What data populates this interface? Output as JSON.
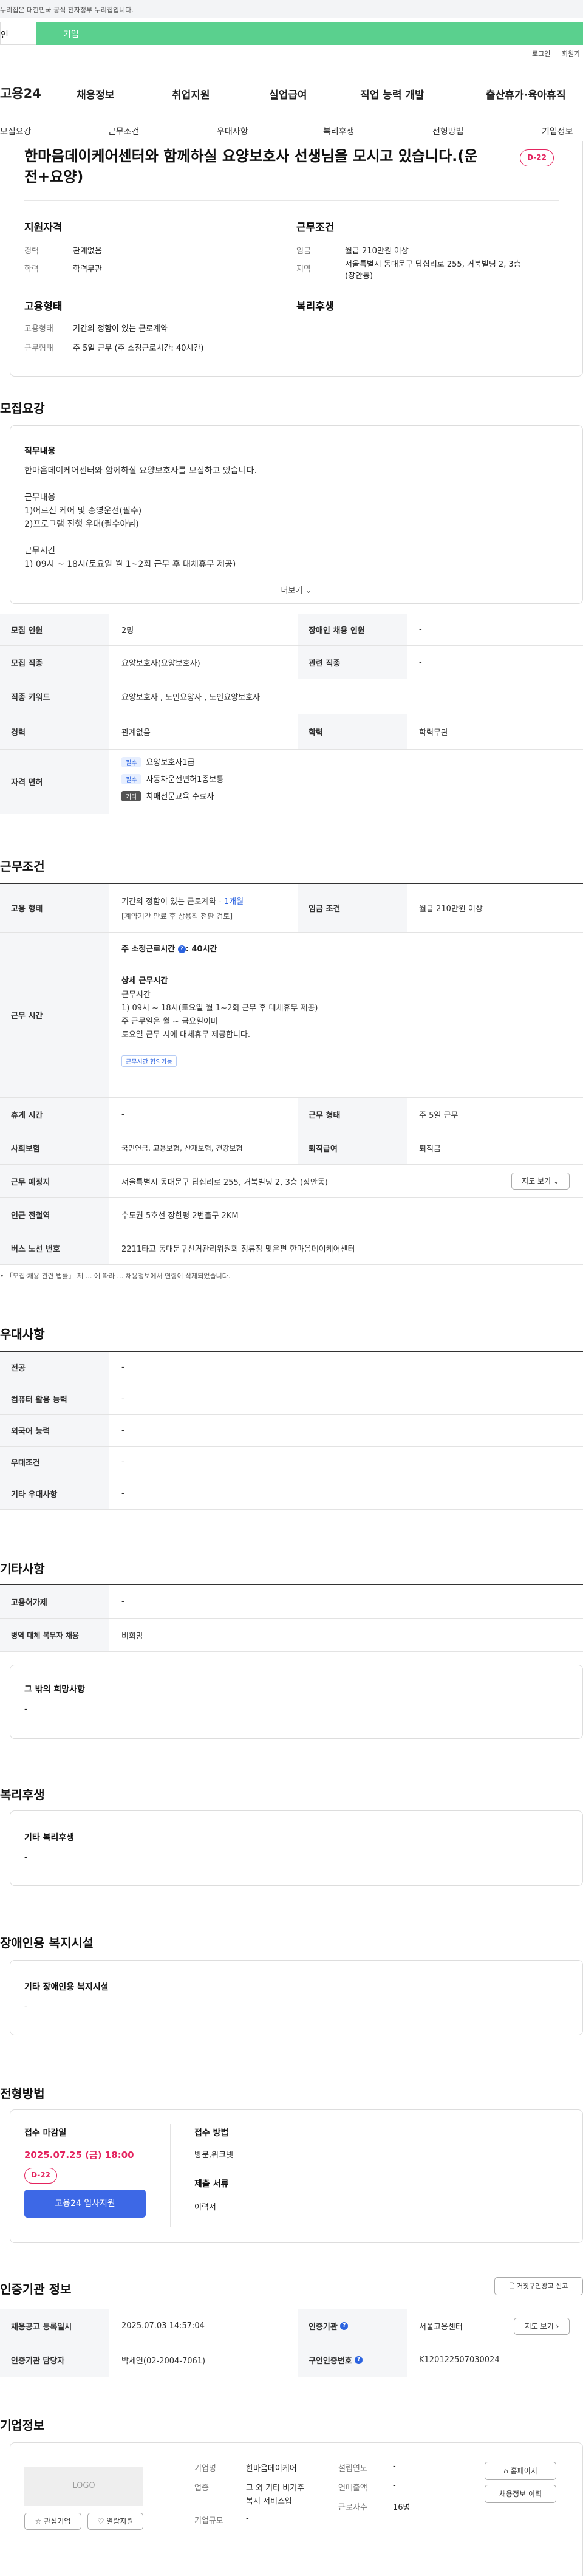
{
  "gov_banner": "누리집은 대한민국 공식 전자정부 누리집입니다.",
  "tabs": {
    "personal": "인",
    "corp": "기업"
  },
  "util": {
    "login": "로그인",
    "join": "회원가"
  },
  "gnb": {
    "logo": "고용24",
    "menu": [
      "채용정보",
      "취업지원",
      "실업급여",
      "직업 능력 개발",
      "출산휴가·육아휴직"
    ]
  },
  "anchors": [
    "모집요강",
    "근무조건",
    "우대사항",
    "복리후생",
    "전형방법",
    "기업정보"
  ],
  "summary": {
    "title_line1": "한마음데이케어센터와 함께하실 요양보호사 선생님을 모시고 있습니다.(운",
    "title_line2": "전+요양)",
    "dday": "D-22",
    "qual_title": "지원자격",
    "career_label": "경력",
    "career": "관계없음",
    "edu_label": "학력",
    "edu": "학력무관",
    "work_title": "근무조건",
    "wage_label": "임금",
    "wage": "월급 210만원 이상",
    "region_label": "지역",
    "region_line1": "서울특별시 동대문구 답십리로 255, 거북빌딩 2, 3층",
    "region_line2": "(장안동)",
    "emp_title": "고용형태",
    "emptype_label": "고용형태",
    "emptype": "기간의 정함이 있는 근로계약",
    "hours_label": "근무형태",
    "hours": "주 5일 근무 (주 소정근로시간: 40시간)",
    "welfare_title": "복리후생"
  },
  "recruit": {
    "heading": "모집요강",
    "job_title": "직무내용",
    "job_text": "한마음데이케어센터와 함께하실 요양보호사를 모집하고 있습니다.\n\n근무내용\n1)어르신 케어 및 송영운전(필수)\n2)프로그램 진행 우대(필수아님)\n\n근무시간\n1) 09시 ~ 18시(토요일 월 1~2회 근무 후 대체휴무 제공)\n주 근무일은 월 ~ 금요일이며",
    "more": "더보기 ⌄",
    "rows": {
      "count_label": "모집 인원",
      "count": "2명",
      "disabled_label": "장애인 채용 인원",
      "disabled": "-",
      "job_label": "모집 직종",
      "job": "요양보호사(요양보호사)",
      "related_label": "관련 직종",
      "related": "-",
      "keyword_label": "직종 키워드",
      "keyword": "요양보호사 , 노인요양사 , 노인요양보호사",
      "career_label": "경력",
      "career": "관계없음",
      "edu_label": "학력",
      "edu": "학력무관",
      "license_label": "자격 면허",
      "licenses": [
        {
          "tag": "필수",
          "name": "요양보호사1급"
        },
        {
          "tag": "필수",
          "name": "자동차운전면허1종보통"
        },
        {
          "tag": "기타",
          "name": "치매전문교육 수료자"
        }
      ]
    }
  },
  "conditions": {
    "heading": "근무조건",
    "emptype_label": "고용 형태",
    "emptype": "기간의 정함이 있는 근로계약 - ",
    "emptype_period": "1개월",
    "emptype_sub": "[계약기간 만료 후 상용직 전환 검토]",
    "wage_label": "임금 조건",
    "wage": "월급 210만원 이상",
    "time_label": "근무 시간",
    "weekly": "주 소정근로시간",
    "weekly_hours": ": 40시간",
    "detail_title": "상세 근무시간",
    "detail_text": "근무시간\n1) 09시 ~ 18시(토요일 월 1~2회 근무 후 대체휴무 제공)\n주 근무일은 월 ~ 금요일이며\n토요일 근무 시에 대체휴무 제공합니다.",
    "flex_badge": "근무시간 협의가능",
    "rest_label": "휴게 시간",
    "rest": "-",
    "shift_label": "근무 형태",
    "shift": "주 5일 근무",
    "insurance_label": "사회보험",
    "insurance": "국민연금, 고용보험, 산재보험, 건강보험",
    "retire_label": "퇴직급여",
    "retire": "퇴직금",
    "place_label": "근무 예정지",
    "place": "서울특별시 동대문구 답십리로 255, 거북빌딩 2, 3층 (장안동)",
    "map_btn": "지도 보기 ⌄",
    "subway_label": "인근 전철역",
    "subway": "수도권 5호선 장한평 2번출구 2KM",
    "bus_label": "버스 노선 번호",
    "bus": "2211타고 동대문구선거관리위원회 정류장 맞은편 한마음데이케어센터",
    "note": "「모집·채용 관련 법률」 제 … 에 따라 … 채용정보에서 연령이 삭제되었습니다."
  },
  "prefer": {
    "heading": "우대사항",
    "rows": [
      {
        "label": "전공",
        "value": "-"
      },
      {
        "label": "컴퓨터 활용 능력",
        "value": "-"
      },
      {
        "label": "외국어 능력",
        "value": "-"
      },
      {
        "label": "우대조건",
        "value": "-"
      },
      {
        "label": "기타 우대사항",
        "value": "-"
      }
    ]
  },
  "etc": {
    "heading": "기타사항",
    "rows": [
      {
        "label": "고용허가제",
        "value": "-"
      },
      {
        "label": "병역 대체 복무자 채용",
        "value": "비희망"
      }
    ],
    "wish_title": "그 밖의 희망사항",
    "wish": "-"
  },
  "welfare": {
    "heading": "복리후생",
    "title": "기타 복리후생",
    "value": "-"
  },
  "facility": {
    "heading": "장애인용 복지시설",
    "title": "기타 장애인용 복지시설",
    "value": "-"
  },
  "selection": {
    "heading": "전형방법",
    "deadline_label": "접수 마감일",
    "deadline": "2025.07.25 (금) 18:00",
    "dday": "D-22",
    "apply_btn": "고용24 입사지원",
    "method_label": "접수 방법",
    "method": "방문,워크넷",
    "docs_label": "제출 서류",
    "docs": "이력서"
  },
  "cert": {
    "heading": "인증기관 정보",
    "report_btn": "거짓구인광고 신고",
    "reg_label": "채용공고 등록일시",
    "reg": "2025.07.03 14:57:04",
    "org_label": "인증기관",
    "org": "서울고용센터",
    "map_btn": "지도 보기 ›",
    "manager_label": "인증기관 담당자",
    "manager": "박세연(02-2004-7061)",
    "job_no_label": "구인인증번호",
    "job_no": "K120122507030024"
  },
  "company": {
    "heading": "기업정보",
    "logo": "LOGO",
    "fav_btn": "☆ 관심기업",
    "apply_btn": "♡ 열람지원",
    "name_label": "기업명",
    "name": "한마음데이케어",
    "type_label": "업종",
    "type_line1": "그 외 기타 비거주",
    "type_line2": "복지 서비스업",
    "size_label": "기업규모",
    "size": "-",
    "year_label": "설립연도",
    "year": "-",
    "sales_label": "연매출액",
    "sales": "-",
    "emp_label": "근로자수",
    "emp": "16명",
    "home_btn": "홈페이지",
    "history_btn": "채용정보 이력"
  }
}
